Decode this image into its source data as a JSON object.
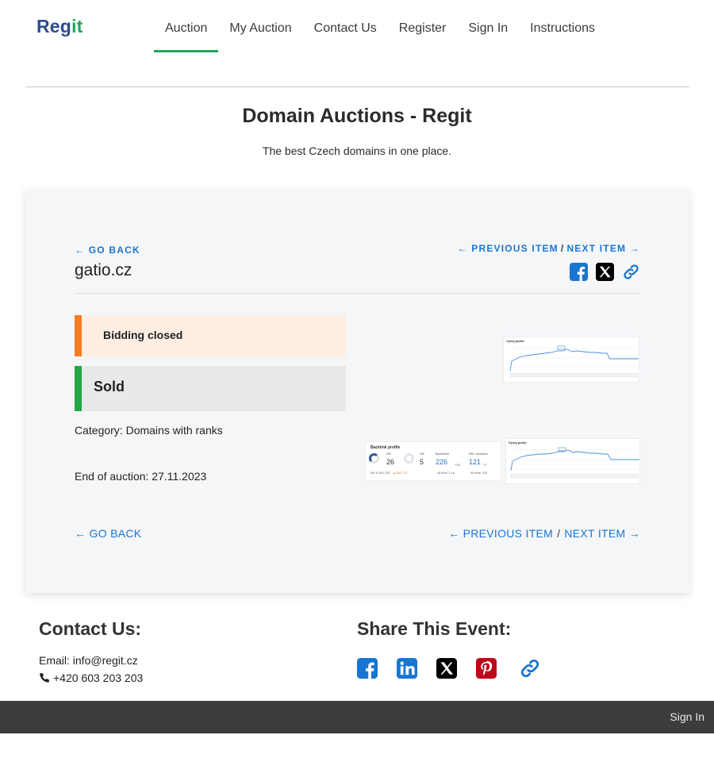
{
  "brand": {
    "logo_part1": "Reg",
    "logo_part2": "it"
  },
  "nav": {
    "items": [
      {
        "label": "Auction",
        "active": true
      },
      {
        "label": "My Auction"
      },
      {
        "label": "Contact Us"
      },
      {
        "label": "Register"
      },
      {
        "label": "Sign In"
      },
      {
        "label": "Instructions"
      }
    ]
  },
  "header": {
    "title": "Domain Auctions - Regit",
    "subtitle": "The best Czech domains in one place."
  },
  "auction": {
    "go_back": "GO BACK",
    "previous_item": "PREVIOUS ITEM",
    "next_item": "NEXT ITEM",
    "separator": "/",
    "domain": "gatio.cz",
    "status_closed": "Bidding closed",
    "status_sold": "Sold",
    "category": "Category: Domains with ranks",
    "end_of_auction": "End of auction: 27.11.2023",
    "go_back_bottom": "GO BACK",
    "previous_item_bottom": "PREVIOUS ITEM",
    "next_item_bottom": "NEXT ITEM",
    "status_colors": {
      "closed_accent": "#f47d24",
      "closed_bg": "#fdeee4",
      "sold_accent": "#24a546",
      "sold_bg": "#e7e9ea"
    }
  },
  "thumbnails": {
    "chart1_title": "Vývoj počtu",
    "backlink": {
      "title": "Backlink profile",
      "dr_label": "DR",
      "dr_value": "26",
      "ur_label": "UR",
      "ur_value": "5",
      "backlinks_label": "Backlinks",
      "backlinks_value": "226",
      "backlinks_delta": "+15",
      "ref_domains_label": "Ref. domains",
      "ref_domains_value": "121",
      "ref_domains_delta": "+7",
      "ar_line": "AR 6,364,753",
      "ar_delta": "▲256 722",
      "alltime1": "All time 1.1K",
      "alltime2": "All time 705"
    },
    "chart3_title": "Vývoj počtu"
  },
  "footer": {
    "contact_title": "Contact Us:",
    "email": "Email: info@regit.cz",
    "phone": "+420 603 203 203",
    "share_title": "Share This Event:",
    "share_icons": [
      "facebook-icon",
      "linkedin-icon",
      "x-icon",
      "pinterest-icon",
      "link-icon"
    ]
  },
  "bottom_bar": {
    "sign_in": "Sign In"
  },
  "colors": {
    "brand_blue": "#2d4b8e",
    "brand_green": "#1fa55a",
    "link": "#1876d2",
    "facebook": "#1877f2",
    "linkedin": "#0a66c2",
    "pinterest": "#bd081c",
    "footer_bar": "#3d3d3d"
  }
}
